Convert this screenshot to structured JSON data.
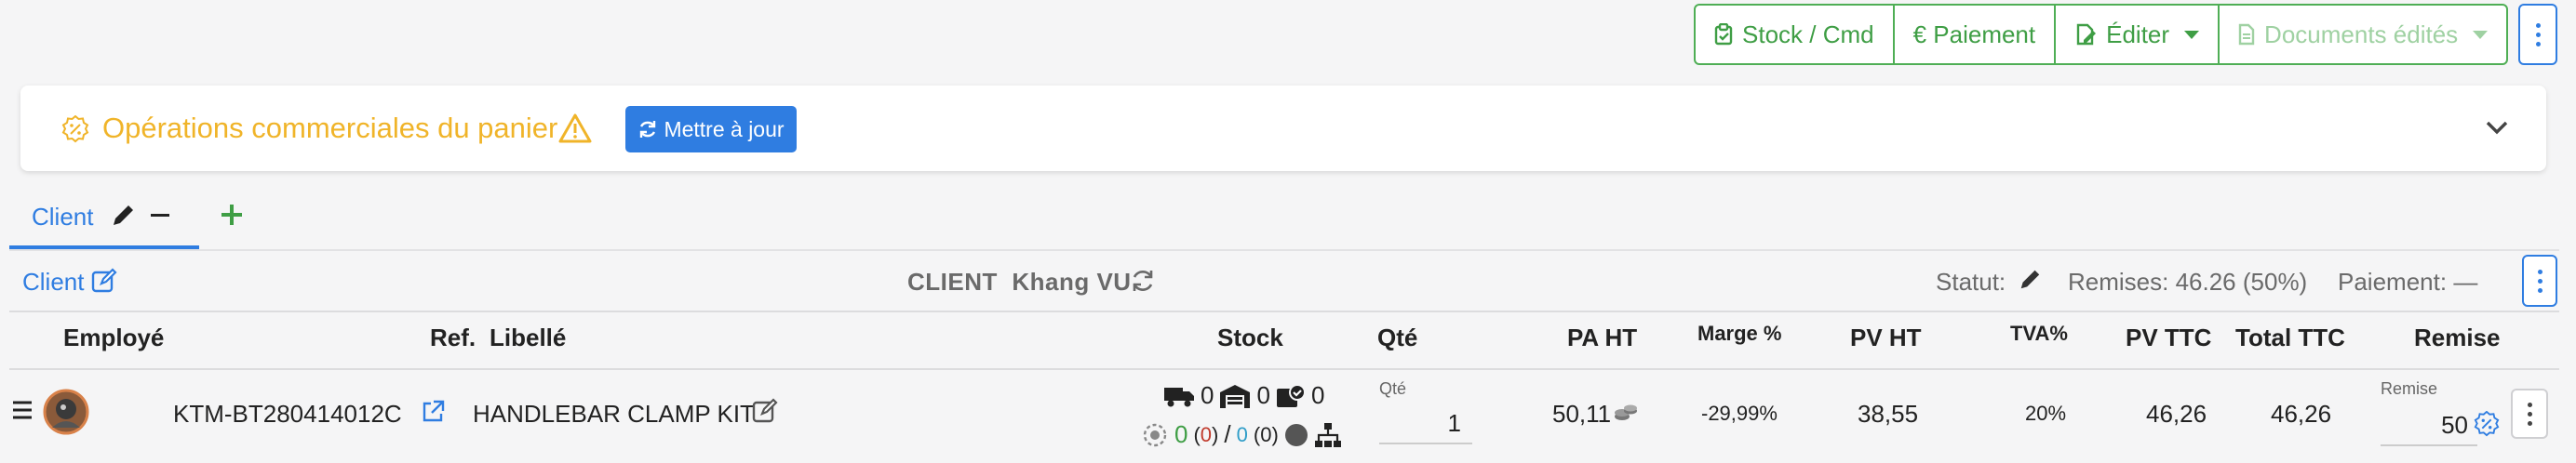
{
  "toolbar": {
    "stock_label": "Stock / Cmd",
    "paiement_label": "€ Paiement",
    "editer_label": "Éditer",
    "documents_label": "Documents édités"
  },
  "promo": {
    "title": "Opérations commerciales du panier",
    "update_label": "Mettre à jour"
  },
  "tabs": {
    "client_label": "Client"
  },
  "client_bar": {
    "client_link": "Client",
    "client_tag": "CLIENT",
    "client_name": "Khang VU",
    "statut_label": "Statut:",
    "remises_text": "Remises: 46.26 (50%)",
    "paiement_label": "Paiement:",
    "paiement_value": "—"
  },
  "table": {
    "headers": {
      "employe": "Employé",
      "ref": "Ref.",
      "libelle": "Libellé",
      "stock": "Stock",
      "qte": "Qté",
      "pa_ht": "PA HT",
      "marge": "Marge %",
      "pv_ht": "PV HT",
      "tva": "TVA%",
      "pv_ttc": "PV TTC",
      "total_ttc": "Total TTC",
      "remise": "Remise"
    },
    "row": {
      "ref": "KTM-BT280414012C",
      "libelle": "HANDLEBAR CLAMP KIT",
      "stock_truck": "0",
      "stock_warehouse": "0",
      "stock_box": "0",
      "stock_green": "0",
      "stock_red": "0",
      "stock_slash": "/",
      "stock_blue": "0",
      "qte_label": "Qté",
      "qte_value": "1",
      "pa_ht": "50,11",
      "marge": "-29,99%",
      "pv_ht": "38,55",
      "tva": "20%",
      "pv_ttc": "46,26",
      "total_ttc": "46,26",
      "remise_label": "Remise",
      "remise_value": "50"
    }
  },
  "colors": {
    "accent_blue": "#2f7de1",
    "green": "#3f9e45",
    "warning_yellow": "#f0b429",
    "negative_red": "#c0392b"
  }
}
